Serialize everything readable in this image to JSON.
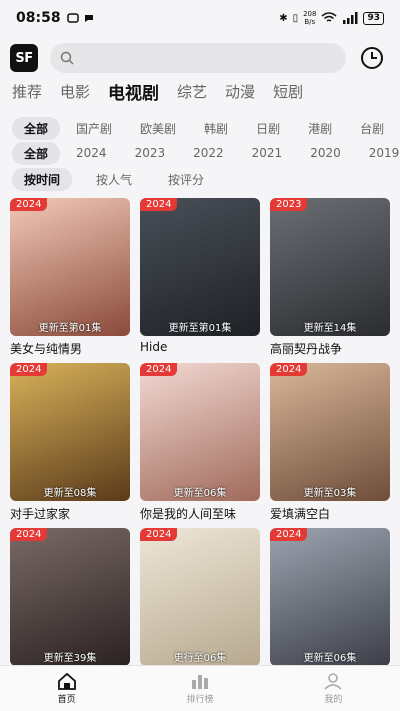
{
  "status": {
    "time": "08:58",
    "net_speed_value": "208",
    "net_speed_unit": "B/s",
    "battery": "93"
  },
  "search": {
    "placeholder": ""
  },
  "logo": {
    "text": "SF"
  },
  "main_tabs": [
    "推荐",
    "电影",
    "电视剧",
    "综艺",
    "动漫",
    "短剧"
  ],
  "main_tab_active": "电视剧",
  "filters": {
    "region": [
      "全部",
      "国产剧",
      "欧美剧",
      "韩剧",
      "日剧",
      "港剧",
      "台剧"
    ],
    "year": [
      "全部",
      "2024",
      "2023",
      "2022",
      "2021",
      "2020",
      "2019"
    ],
    "sort": [
      "按时间",
      "按人气",
      "按评分"
    ]
  },
  "cards": [
    {
      "title": "美女与纯情男",
      "year": "2024",
      "status": "更新至第01集",
      "bg1": "#f2c9b8",
      "bg2": "#8a4a3a"
    },
    {
      "title": "Hide",
      "year": "2024",
      "status": "更新至第01集",
      "bg1": "#4a4f58",
      "bg2": "#1e2126"
    },
    {
      "title": "高丽契丹战争",
      "year": "2023",
      "status": "更新至14集",
      "bg1": "#6b6f74",
      "bg2": "#2a2c30"
    },
    {
      "title": "对手过家家",
      "year": "2024",
      "status": "更新至08集",
      "bg1": "#d8b25a",
      "bg2": "#5a3a1a"
    },
    {
      "title": "你是我的人间至味",
      "year": "2024",
      "status": "更新至06集",
      "bg1": "#f3d9d4",
      "bg2": "#a06a5a"
    },
    {
      "title": "爱填满空白",
      "year": "2024",
      "status": "更新至03集",
      "bg1": "#d9b79a",
      "bg2": "#6e4d3a"
    },
    {
      "title": "",
      "year": "2024",
      "status": "更新至39集",
      "bg1": "#7a6a66",
      "bg2": "#2b2222"
    },
    {
      "title": "",
      "year": "2024",
      "status": "更行至06集",
      "bg1": "#ede6d8",
      "bg2": "#b7a98f"
    },
    {
      "title": "",
      "year": "2024",
      "status": "更新至06集",
      "bg1": "#9da3b0",
      "bg2": "#3c3f48"
    }
  ],
  "nav": [
    {
      "label": "首页",
      "icon": "home-icon",
      "active": true
    },
    {
      "label": "排行榜",
      "icon": "chart-icon",
      "active": false
    },
    {
      "label": "我的",
      "icon": "user-icon",
      "active": false
    }
  ]
}
